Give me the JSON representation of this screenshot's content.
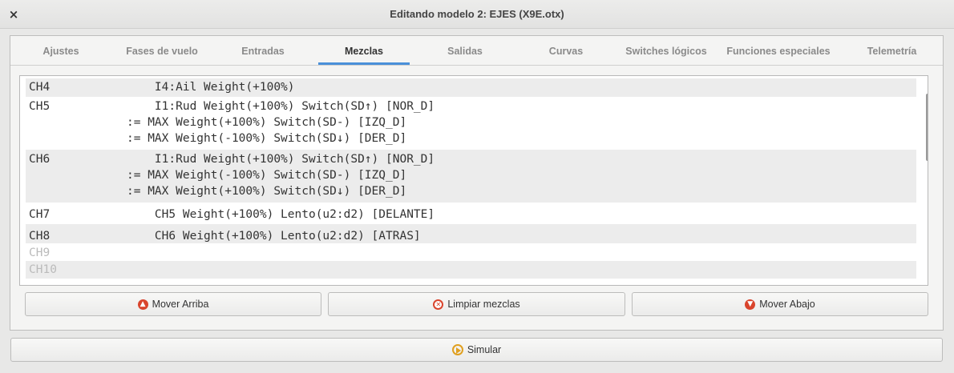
{
  "window": {
    "title": "Editando modelo 2: EJES    (X9E.otx)",
    "close_label": "×"
  },
  "tabs": [
    {
      "label": "Ajustes"
    },
    {
      "label": "Fases de vuelo"
    },
    {
      "label": "Entradas"
    },
    {
      "label": "Mezclas"
    },
    {
      "label": "Salidas"
    },
    {
      "label": "Curvas"
    },
    {
      "label": "Switches lógicos"
    },
    {
      "label": "Funciones especiales"
    },
    {
      "label": "Telemetría"
    }
  ],
  "active_tab": "Mezclas",
  "mixes": [
    {
      "channel": "CH4",
      "lines": [
        "    I4:Ail Weight(+100%)"
      ]
    },
    {
      "channel": "CH5",
      "lines": [
        "    I1:Rud Weight(+100%) Switch(SD↑) [NOR_D]",
        ":= MAX Weight(+100%) Switch(SD-) [IZQ_D]",
        ":= MAX Weight(-100%) Switch(SD↓) [DER_D]"
      ]
    },
    {
      "channel": "CH6",
      "lines": [
        "    I1:Rud Weight(+100%) Switch(SD↑) [NOR_D]",
        ":= MAX Weight(-100%) Switch(SD-) [IZQ_D]",
        ":= MAX Weight(+100%) Switch(SD↓) [DER_D]"
      ]
    },
    {
      "channel": "CH7",
      "lines": [
        "    CH5 Weight(+100%) Lento(u2:d2) [DELANTE]"
      ]
    },
    {
      "channel": "CH8",
      "lines": [
        "    CH6 Weight(+100%) Lento(u2:d2) [ATRAS]"
      ]
    },
    {
      "channel": "CH9",
      "lines": []
    },
    {
      "channel": "CH10",
      "lines": []
    }
  ],
  "buttons": {
    "move_up": "Mover Arriba",
    "clear": "Limpiar mezclas",
    "move_down": "Mover Abajo",
    "simulate": "Simular"
  },
  "colors": {
    "accent": "#4a90d9",
    "icon_red": "#d9442c",
    "icon_orange": "#e0a020"
  }
}
